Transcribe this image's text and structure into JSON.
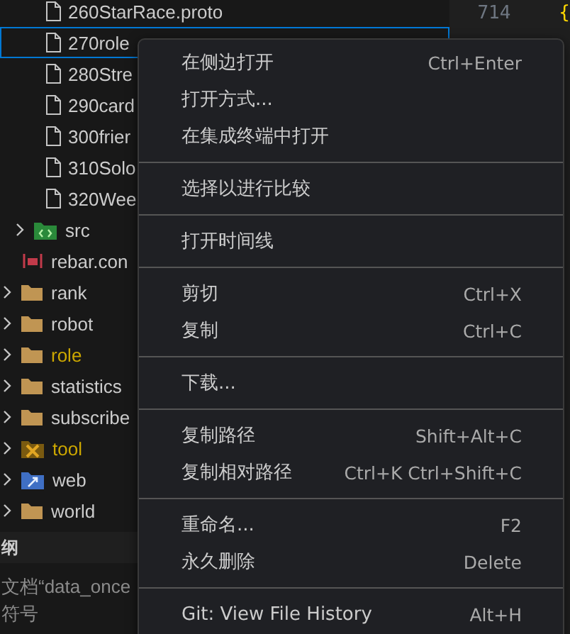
{
  "explorer": {
    "nested_files": [
      {
        "name": "260StarRace.proto",
        "kind": "file",
        "selected": false
      },
      {
        "name": "270role",
        "kind": "file",
        "selected": true
      },
      {
        "name": "280Stre",
        "kind": "file",
        "selected": false
      },
      {
        "name": "290card",
        "kind": "file",
        "selected": false
      },
      {
        "name": "300frier",
        "kind": "file",
        "selected": false
      },
      {
        "name": "310Solo",
        "kind": "file",
        "selected": false
      },
      {
        "name": "320Wee",
        "kind": "file",
        "selected": false
      }
    ],
    "project_items": [
      {
        "name": "src",
        "kind": "code-folder",
        "expanded": false,
        "modified": false
      },
      {
        "name": "rebar.con",
        "kind": "config-file",
        "modified": false
      }
    ],
    "folders": [
      {
        "name": "rank",
        "kind": "folder",
        "expanded": false,
        "modified": false
      },
      {
        "name": "robot",
        "kind": "folder",
        "expanded": false,
        "modified": false
      },
      {
        "name": "role",
        "kind": "folder",
        "expanded": false,
        "modified": true
      },
      {
        "name": "statistics",
        "kind": "folder",
        "expanded": false,
        "modified": false
      },
      {
        "name": "subscribe",
        "kind": "folder",
        "expanded": false,
        "modified": false
      },
      {
        "name": "tool",
        "kind": "tool-folder",
        "expanded": false,
        "modified": true
      },
      {
        "name": "web",
        "kind": "web-folder",
        "expanded": false,
        "modified": false
      },
      {
        "name": "world",
        "kind": "folder",
        "expanded": false,
        "modified": false
      }
    ]
  },
  "outline_panel": {
    "title": "纲",
    "lines": [
      "文档“data_once",
      "符号"
    ]
  },
  "editor": {
    "line_number": "714",
    "code": "{"
  },
  "context_menu": {
    "groups": [
      [
        {
          "label": "在侧边打开",
          "shortcut": "Ctrl+Enter"
        },
        {
          "label": "打开方式..."
        },
        {
          "label": "在集成终端中打开"
        }
      ],
      [
        {
          "label": "选择以进行比较"
        }
      ],
      [
        {
          "label": "打开时间线"
        }
      ],
      [
        {
          "label": "剪切",
          "shortcut": "Ctrl+X"
        },
        {
          "label": "复制",
          "shortcut": "Ctrl+C"
        }
      ],
      [
        {
          "label": "下载..."
        }
      ],
      [
        {
          "label": "复制路径",
          "shortcut": "Shift+Alt+C"
        },
        {
          "label": "复制相对路径",
          "shortcut": "Ctrl+K Ctrl+Shift+C"
        }
      ],
      [
        {
          "label": "重命名...",
          "shortcut": "F2"
        },
        {
          "label": "永久删除",
          "shortcut": "Delete"
        }
      ],
      [
        {
          "label": "Git: View File History",
          "shortcut": "Alt+H"
        }
      ]
    ]
  }
}
